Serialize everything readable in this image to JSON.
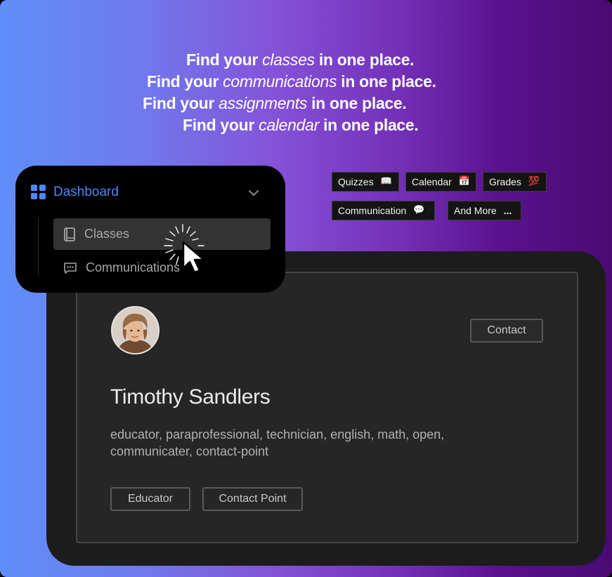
{
  "headlines": [
    {
      "pre": "Find your",
      "em": "classes",
      "post": "in one place."
    },
    {
      "pre": "Find your",
      "em": "communications",
      "post": "in one place."
    },
    {
      "pre": "Find your",
      "em": "assignments",
      "post": "in one place."
    },
    {
      "pre": "Find your",
      "em": "calendar",
      "post": "in one place."
    }
  ],
  "chips": [
    {
      "label": "Quizzes",
      "emoji": "📖"
    },
    {
      "label": "Calendar",
      "emoji": "📅"
    },
    {
      "label": "Grades",
      "emoji": "💯"
    },
    {
      "label": "Communication",
      "emoji": "💬"
    },
    {
      "label": "And More",
      "emoji": "..."
    }
  ],
  "sidebar": {
    "title": "Dashboard",
    "items": [
      {
        "label": "Classes",
        "icon": "book-icon",
        "active": true
      },
      {
        "label": "Communications",
        "icon": "message-icon",
        "active": false
      }
    ]
  },
  "profile": {
    "name": "Timothy Sandlers",
    "tags": "educator, paraprofessional, technician, english, math, open, communicater, contact-point",
    "contact_label": "Contact",
    "roles": [
      "Educator",
      "Contact Point"
    ]
  },
  "colors": {
    "accent": "#4f86f7",
    "gradient_start": "#5f8ef8",
    "gradient_end": "#4a0a72",
    "card_bg": "#262626"
  }
}
